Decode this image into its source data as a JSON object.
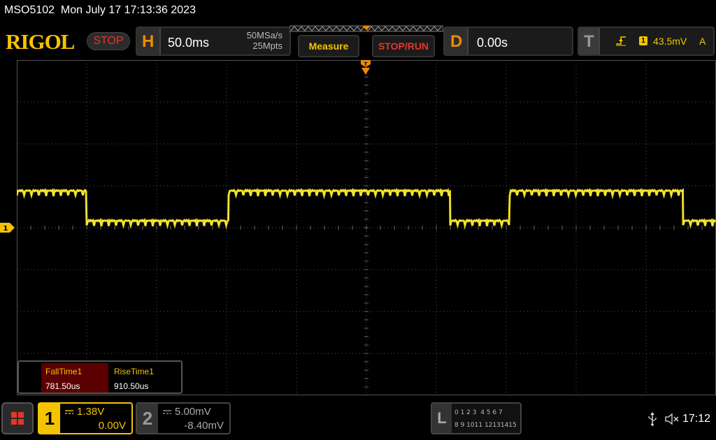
{
  "title_bar": {
    "text": "MSO5102  Mon July 17 17:13:36 2023"
  },
  "top": {
    "logo": "RIGOL",
    "state": "STOP",
    "horizontal": {
      "letter": "H",
      "timebase": "50.0ms",
      "sample_rate": "50MSa/s",
      "memory_depth": "25Mpts"
    },
    "measure_button": "Measure",
    "stoprun_button": "STOP/RUN",
    "delay": {
      "letter": "D",
      "value": "0.00s"
    },
    "trigger": {
      "letter": "T",
      "channel": "1",
      "level": "43.5mV",
      "mode": "A",
      "edge_icon": "rising-edge-icon"
    }
  },
  "screen": {
    "trace_color": "#f5e400",
    "ch1_marker_label": "1",
    "grid_divisions": {
      "horizontal": 10,
      "vertical": 8
    }
  },
  "measurements": [
    {
      "name": "FallTime1",
      "value": "781.50us"
    },
    {
      "name": "RiseTime1",
      "value": "910.50us"
    }
  ],
  "bottom": {
    "ch1": {
      "number": "1",
      "scale": "1.38V",
      "offset": "0.00V"
    },
    "ch2": {
      "number": "2",
      "scale": "5.00mV",
      "offset": "-8.40mV"
    },
    "la": {
      "letter": "L",
      "row1": "0 1 2 3  4 5 6 7",
      "row2": "8 9 1011 12131415"
    },
    "time": "17:12"
  },
  "colors": {
    "accent_yellow": "#f5c400",
    "orange": "#f08a00",
    "stop_red": "#e4362b"
  }
}
